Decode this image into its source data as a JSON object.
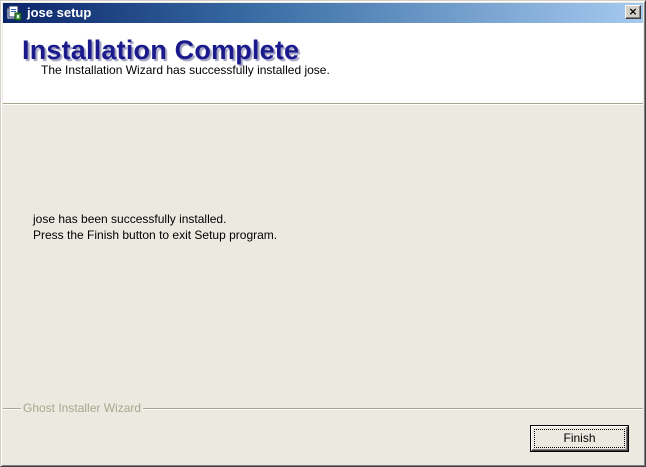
{
  "window": {
    "title": "jose setup",
    "close_label": "×"
  },
  "header": {
    "title": "Installation Complete",
    "subtitle": "The Installation Wizard has successfully installed jose."
  },
  "body": {
    "lines": [
      "jose has been successfully installed.",
      "Press the Finish button to exit Setup program."
    ]
  },
  "footer": {
    "group_label": "Ghost Installer Wizard",
    "finish_label": "Finish"
  },
  "colors": {
    "titlebar_start": "#0a246a",
    "titlebar_end": "#a6caf0",
    "header_title": "#1a1a8c",
    "dialog_background": "#ece9e0",
    "group_label": "#a8a690"
  },
  "icons": {
    "app": "setup-installer-icon",
    "close": "close-icon"
  }
}
